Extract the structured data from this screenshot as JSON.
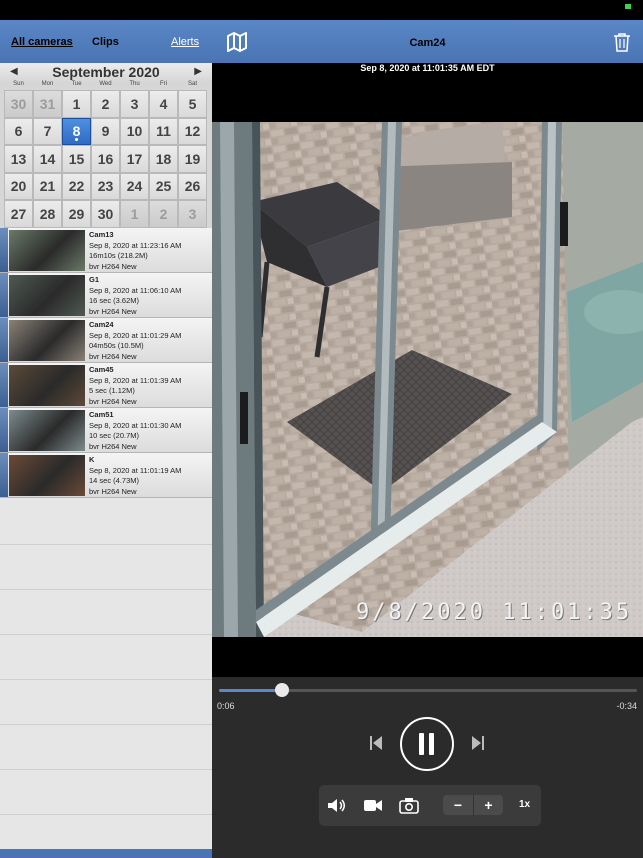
{
  "left_tabs": {
    "all": "All cameras",
    "clips": "Clips",
    "alerts": "Alerts"
  },
  "calendar": {
    "month": "September 2020",
    "prev_icon": "triangle-left",
    "next_icon": "triangle-right",
    "weekdays": [
      "Sun",
      "Mon",
      "Tue",
      "Wed",
      "Thu",
      "Fri",
      "Sat"
    ],
    "days": [
      {
        "d": "30",
        "muted": true
      },
      {
        "d": "31",
        "muted": true
      },
      {
        "d": "1"
      },
      {
        "d": "2"
      },
      {
        "d": "3"
      },
      {
        "d": "4"
      },
      {
        "d": "5"
      },
      {
        "d": "6"
      },
      {
        "d": "7"
      },
      {
        "d": "8",
        "selected": true
      },
      {
        "d": "9"
      },
      {
        "d": "10"
      },
      {
        "d": "11"
      },
      {
        "d": "12"
      },
      {
        "d": "13"
      },
      {
        "d": "14"
      },
      {
        "d": "15"
      },
      {
        "d": "16"
      },
      {
        "d": "17"
      },
      {
        "d": "18"
      },
      {
        "d": "19"
      },
      {
        "d": "20"
      },
      {
        "d": "21"
      },
      {
        "d": "22"
      },
      {
        "d": "23"
      },
      {
        "d": "24"
      },
      {
        "d": "25"
      },
      {
        "d": "26"
      },
      {
        "d": "27"
      },
      {
        "d": "28"
      },
      {
        "d": "29"
      },
      {
        "d": "30"
      },
      {
        "d": "1",
        "muted": true
      },
      {
        "d": "2",
        "muted": true
      },
      {
        "d": "3",
        "muted": true
      }
    ]
  },
  "clips": [
    {
      "cam": "Cam13",
      "time": "Sep 8, 2020 at 11:23:16 AM",
      "dur": "16m10s (218.2M)",
      "info": "bvr H264 New",
      "tint": "#6a7a68"
    },
    {
      "cam": "G1",
      "time": "Sep 8, 2020 at 11:06:10 AM",
      "dur": "16 sec (3.62M)",
      "info": "bvr H264 New",
      "tint": "#4f5a52"
    },
    {
      "cam": "Cam24",
      "time": "Sep 8, 2020 at 11:01:29 AM",
      "dur": "04m50s (10.5M)",
      "info": "bvr H264 New",
      "tint": "#8a8176"
    },
    {
      "cam": "Cam45",
      "time": "Sep 8, 2020 at 11:01:39 AM",
      "dur": "5 sec (1.12M)",
      "info": "bvr H264 New",
      "tint": "#5c4a38"
    },
    {
      "cam": "Cam51",
      "time": "Sep 8, 2020 at 11:01:30 AM",
      "dur": "10 sec (20.7M)",
      "info": "bvr H264 New",
      "tint": "#7d8b8e"
    },
    {
      "cam": "K",
      "time": "Sep 8, 2020 at 11:01:19 AM",
      "dur": "14 sec (4.73M)",
      "info": "bvr H264 New",
      "tint": "#6b4a37"
    }
  ],
  "viewer": {
    "title": "Cam24",
    "timestamp": "Sep 8, 2020 at 11:01:35 AM EDT",
    "overlay_ts": "9/8/2020 11:01:35",
    "elapsed": "0:06",
    "remaining": "-0:34",
    "progress": 0.15,
    "speed": "1x",
    "zoom_minus": "−",
    "zoom_plus": "+"
  },
  "icons": {
    "map": "map-icon",
    "trash": "trash-icon",
    "prev": "skip-back-icon",
    "next": "skip-forward-icon",
    "pause": "pause-icon",
    "volume": "speaker-icon",
    "record": "video-camera-icon",
    "snapshot": "camera-icon"
  },
  "colors": {
    "accent": "#4a74b4",
    "selected_day": "#2f6bc4",
    "progress": "#5b88c8"
  }
}
